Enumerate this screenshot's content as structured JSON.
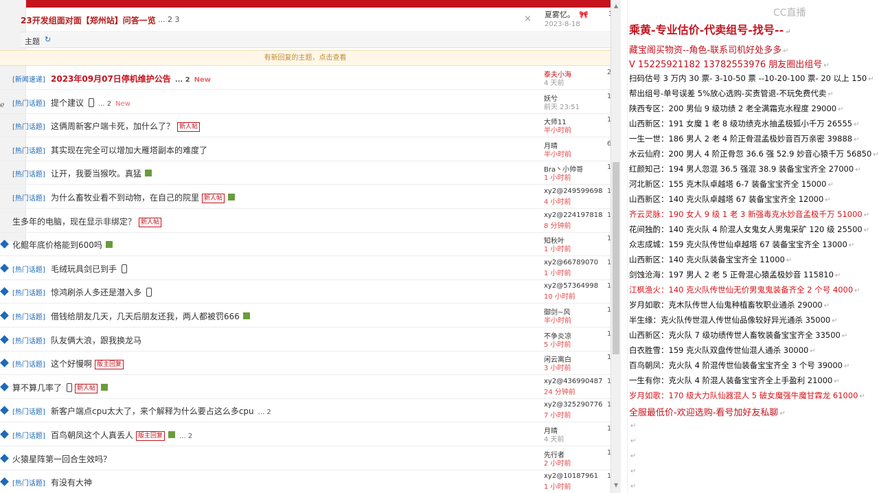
{
  "forum": {
    "sticky": {
      "title": "23开发组面对面【郑州站】问答一览",
      "pages": "... 2  3",
      "close": "×",
      "author": "夏雾忆。",
      "author_icon": "🎀",
      "date": "2023-8-18",
      "right": "3"
    },
    "subhead": {
      "label": "主题",
      "refresh_icon": "↻"
    },
    "notice": "有新回复的主题，点击查看",
    "left_icons": [
      "ℯ"
    ],
    "rows": [
      {
        "cat": "[新闻速递]",
        "title": "2023年09月07日停机维护公告",
        "title_red": true,
        "extra": "... 2",
        "new": "New",
        "author": "泰夫小海",
        "author_red": true,
        "time": "4 天前",
        "time_red": false,
        "rc": "2"
      },
      {
        "cat": "[热门话题]",
        "title": "提个建议",
        "phone": true,
        "extra": "... 2",
        "new": "New",
        "author": "妖兮",
        "time": "前天 23:51",
        "rc": "1"
      },
      {
        "cat": "[热门话题]",
        "title": "这俩周新客户端卡死，加什么了？",
        "tag": "新人帖",
        "author": "大师11",
        "time": "半小时前",
        "time_red": true,
        "rc": "1"
      },
      {
        "cat": "[热门话题]",
        "title": "其实现在完全可以增加大雁塔副本的难度了",
        "author": "月晴",
        "time": "半小时前",
        "time_red": true,
        "rc": "6"
      },
      {
        "cat": "[热门话题]",
        "title": "让开，我要当猴吹。真猛",
        "pic": true,
        "author": "Bra丶小帅哥",
        "time": "1 小时前",
        "time_red": true,
        "rc": "1"
      },
      {
        "cat": "[热门话题]",
        "title": "为什么畜牧业看不到动物，在自己的院里",
        "tag": "新人帖",
        "pic": true,
        "author": "xy2@249599698",
        "time": "4 小时前",
        "time_red": true,
        "rc": "1"
      },
      {
        "cat": "",
        "title": "生多年的电脑，现在显示非绑定？",
        "tag": "新人帖",
        "author": "xy2@224197818",
        "time": "8 分钟前",
        "time_red": true,
        "rc": "1"
      },
      {
        "cat": "",
        "title": "化鲲年底价格能到600吗",
        "pic": true,
        "author": "知秋叶",
        "time": "1 小时前",
        "time_red": true,
        "rc": "1"
      },
      {
        "cat": "[热门话题]",
        "title": "毛绒玩具剑已到手",
        "phone": true,
        "author": "xy2@66789070",
        "time": "1 小时前",
        "time_red": true,
        "rc": "1"
      },
      {
        "cat": "[热门话题]",
        "title": "惊鸿刷杀人多还是潜入多",
        "phone": true,
        "author": "xy2@57364998",
        "time": "10 小时前",
        "time_red": true,
        "rc": "1"
      },
      {
        "cat": "[热门话题]",
        "title": "借钱给朋友几天，几天后朋友还我，两人都被罚666",
        "pic": true,
        "author": "御剑~风",
        "time": "半小时前",
        "time_red": true,
        "rc": "1"
      },
      {
        "cat": "[热门话题]",
        "title": "队友俩大浪，跟我换龙马",
        "author": "不争炎凉",
        "time": "5 小时前",
        "time_red": true,
        "rc": "1"
      },
      {
        "cat": "[热门话题]",
        "title": "这个好慢啊",
        "tag": "版主回复",
        "author": "闲云离白",
        "time": "3 小时前",
        "time_red": true,
        "rc": "1"
      },
      {
        "cat": "",
        "title": "算不算几率了",
        "tag": "新人帖",
        "pic": true,
        "phone": true,
        "author": "xy2@436990487",
        "time": "24 分钟前",
        "time_red": true,
        "rc": "1"
      },
      {
        "cat": "[热门话题]",
        "title": "新客户端点cpu太大了，来个解释为什么要占这么多cpu",
        "extra": "... 2",
        "author": "xy2@325290776",
        "time": "7 小时前",
        "time_red": true,
        "rc": "1"
      },
      {
        "cat": "[热门话题]",
        "title": "百鸟朝凤这个人真丢人",
        "pic": true,
        "tag": "版主回复",
        "extra": "... 2",
        "author": "月晴",
        "time": "4 天前",
        "time_red": false,
        "rc": "1"
      },
      {
        "cat": "",
        "title": "火猿星阵第一回合生效吗？",
        "author": "先行者",
        "time": "2 小时前",
        "time_red": true,
        "rc": "1"
      },
      {
        "cat": "[热门话题]",
        "title": "有没有大神",
        "author": "xy2@10187961",
        "time": "1 小时前",
        "time_red": true,
        "rc": "1"
      }
    ]
  },
  "doc": {
    "watermark": "CC直播",
    "lines": [
      {
        "text": "乘黄-专业估价-代卖组号-找号--",
        "style": "big"
      },
      {
        "text": "藏宝阁买物资--角色-联系司机好处多多",
        "style": "h2"
      },
      {
        "text": "V 15225921182    13782553976 朋友圈出组号",
        "style": "h2"
      },
      {
        "text": "扫码估号 3 万内 30 票- 3-10-50 票   --10-20-100 票-  20 以上 150",
        "style": ""
      },
      {
        "text": "帮出组号-单号误差 5%放心选购-买责管退-不玩免费代卖",
        "style": ""
      },
      {
        "text": "陕西专区：200 男仙 9 级功绩 2 老全满霜克水程度 29000",
        "style": ""
      },
      {
        "text": "山西新区：191 女魔 1 老 8 级功绩克水抽孟极狐小千万 26555",
        "style": ""
      },
      {
        "text": "一生一世：186 男人 2 老 4 阶正骨混孟极妙音百万亲密 39888",
        "style": ""
      },
      {
        "text": "水云仙府：200 男人 4 阶正骨忽 36.6 强 52.9 妙音心猿千万 56850",
        "style": ""
      },
      {
        "text": "红颜知己：194 男人忽混 36.5 强混 38.9 装备宝宝齐全 27000",
        "style": ""
      },
      {
        "text": "河北新区：155 克木队卓越塔 6-7 装备宝宝齐全 15000",
        "style": ""
      },
      {
        "text": "山西新区：140 克火队卓越塔 67 装备宝宝齐全  12000",
        "style": ""
      },
      {
        "text": "齐云灵脉：190 女人 9 级 1 老 3 新强毒克水妙音孟极千万 51000",
        "style": "red"
      },
      {
        "text": "花间独酌：140 克火队 4 阶混人女鬼女人男鬼采矿 120 级 25500",
        "style": ""
      },
      {
        "text": "众志成城：159 克火队传世仙卓越塔 67 装备宝宝齐全 13000",
        "style": ""
      },
      {
        "text": "山西新区：140 克火队装备宝宝齐全 11000",
        "style": ""
      },
      {
        "text": "剑蚀沧海：197 男人 2 老 5 正骨混心猿孟极妙音  115810",
        "style": ""
      },
      {
        "text": "江枫渔火：140 克火队传世仙无价男鬼鬼装备齐全 2 个号 4000",
        "style": "red"
      },
      {
        "text": "岁月如歌：克木队传世人仙鬼种植畜牧职业通杀 29000",
        "style": ""
      },
      {
        "text": "半生缘：克火队传世混人传世仙品像较好异光通杀 35000",
        "style": ""
      },
      {
        "text": "山西新区：克火队 7 级功绩传世人畜牧装备宝宝齐全 33500",
        "style": ""
      },
      {
        "text": "白衣胜雪：159 克火队双盘传世仙混人通杀 30000",
        "style": ""
      },
      {
        "text": "百鸟朝凤：克火队 4 阶混传世仙装备宝宝齐全 3 个号 39000",
        "style": ""
      },
      {
        "text": "一生有你：克火队 4 阶混人装备宝宝齐全上手盈利 21000",
        "style": ""
      },
      {
        "text": "岁月如歌：170 级大力队仙器混人 5 破女魔强牛魔甘霖龙 61000",
        "style": "red"
      },
      {
        "text": "全服最低价-欢迎选购-看号加好友私聊",
        "style": "h2"
      },
      {
        "text": "",
        "style": ""
      },
      {
        "text": "",
        "style": ""
      },
      {
        "text": "",
        "style": ""
      },
      {
        "text": "",
        "style": ""
      },
      {
        "text": "",
        "style": ""
      }
    ],
    "para_mark": "↵"
  },
  "colors": {
    "accent": "#c4131e",
    "link": "#1e6ab8"
  }
}
